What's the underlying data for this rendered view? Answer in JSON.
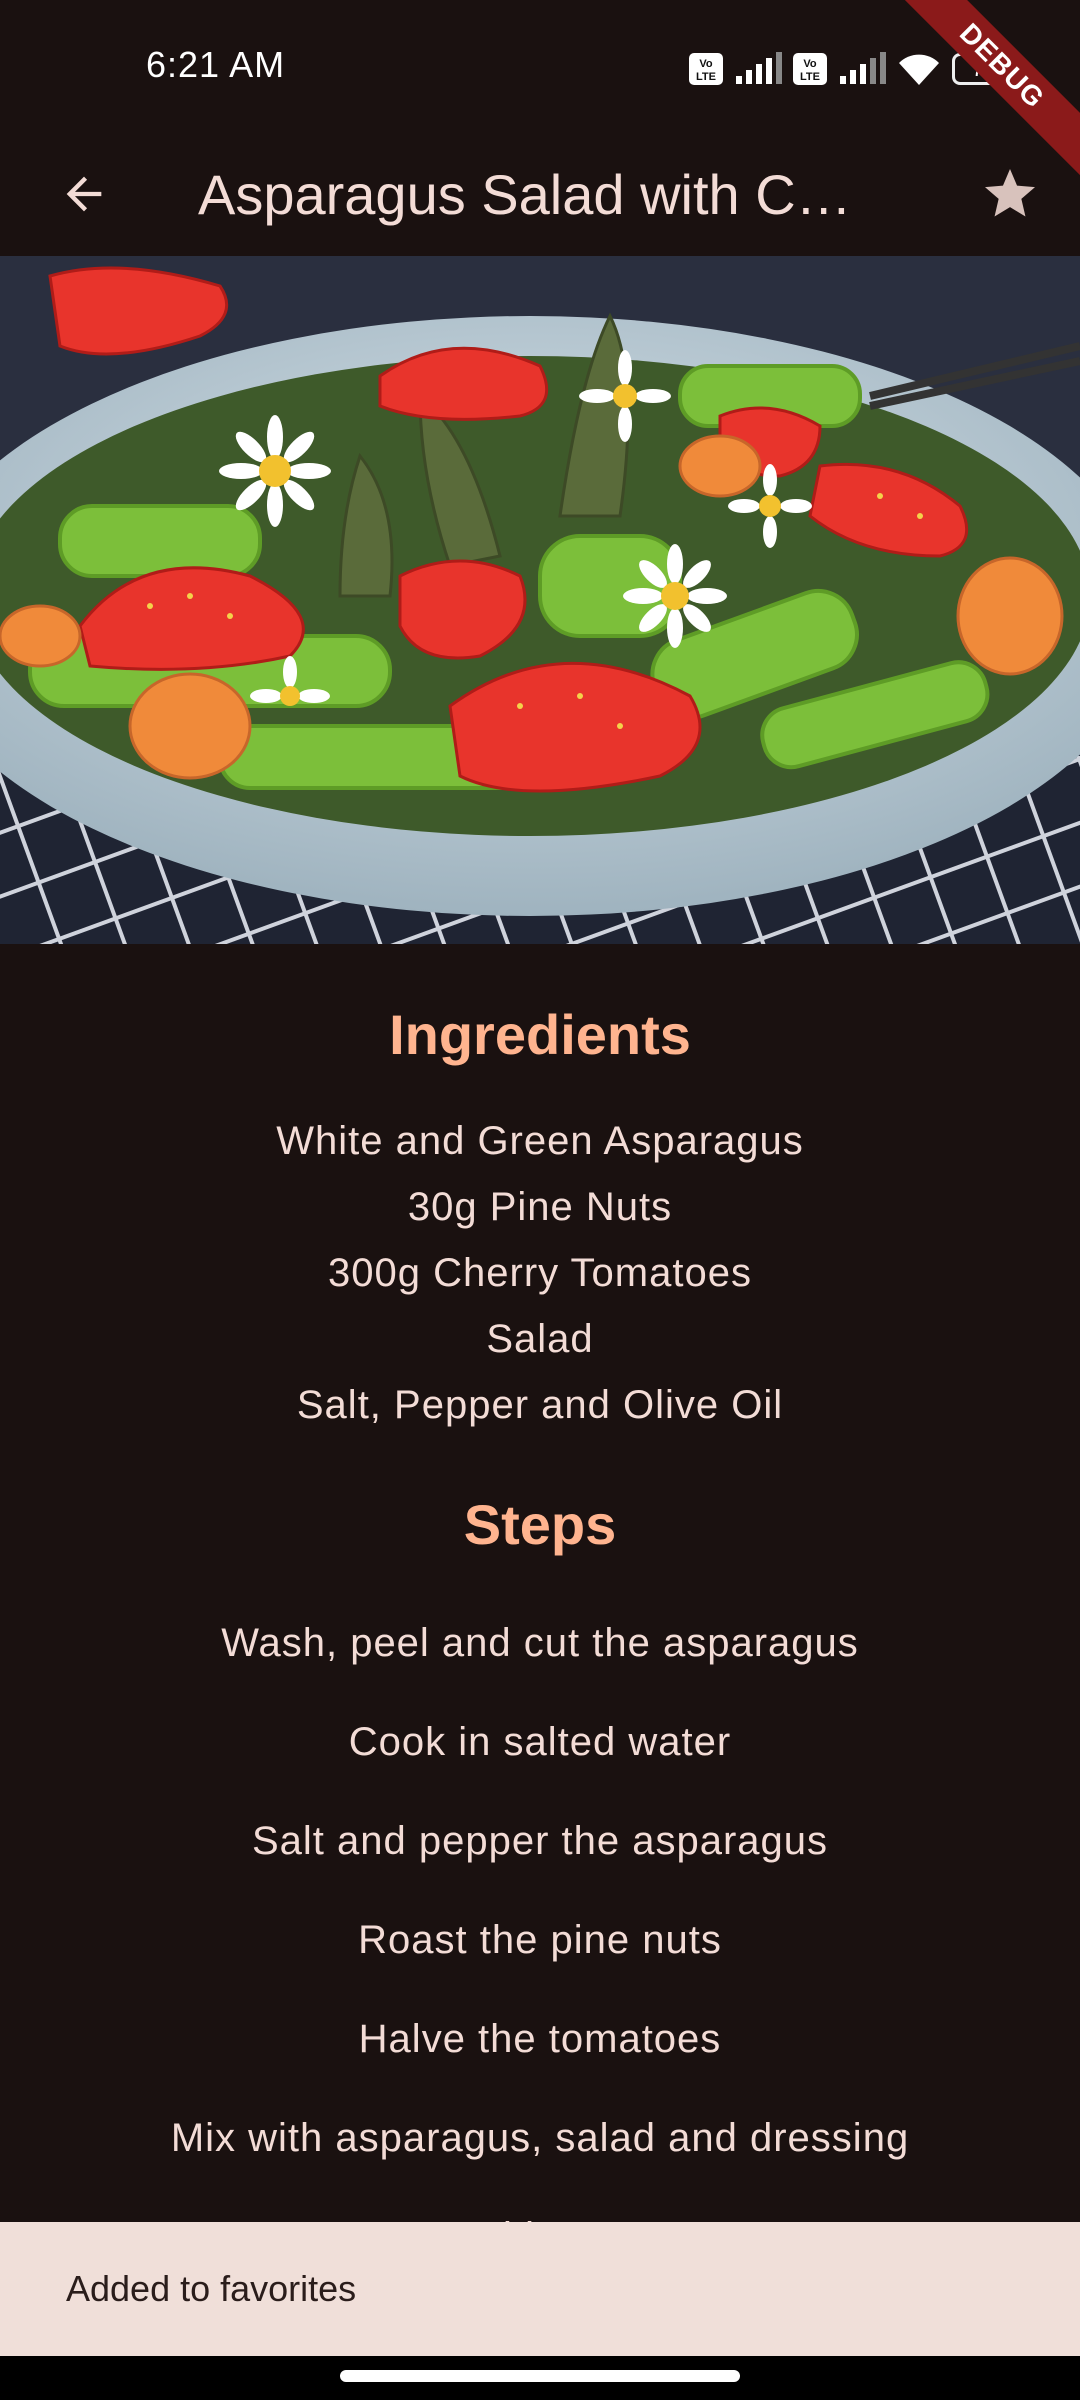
{
  "status_bar": {
    "time": "6:21 AM",
    "battery": "72",
    "icons": [
      "volte-icon",
      "signal-icon",
      "volte-icon",
      "signal-icon",
      "wifi-icon",
      "battery-icon"
    ]
  },
  "debug_ribbon": "DEBUG",
  "app_bar": {
    "title": "Asparagus Salad with C…",
    "back_icon": "arrow-back-icon",
    "favorite_icon": "star-icon"
  },
  "hero_image": {
    "description_icon": "salad-photo"
  },
  "ingredients": {
    "title": "Ingredients",
    "items": [
      "White and Green Asparagus",
      "30g Pine Nuts",
      "300g Cherry Tomatoes",
      "Salad",
      "Salt, Pepper and Olive Oil"
    ]
  },
  "steps": {
    "title": "Steps",
    "items": [
      "Wash, peel and cut the asparagus",
      "Cook in salted water",
      "Salt and pepper the asparagus",
      "Roast the pine nuts",
      "Halve the tomatoes",
      "Mix with asparagus, salad and dressing",
      "Serve with Baguette"
    ]
  },
  "snackbar": {
    "message": "Added to favorites"
  },
  "colors": {
    "background": "#1a1110",
    "accent": "#ffb48f",
    "text": "#f3dcd6",
    "snackbar_bg": "#f0dfd9"
  }
}
